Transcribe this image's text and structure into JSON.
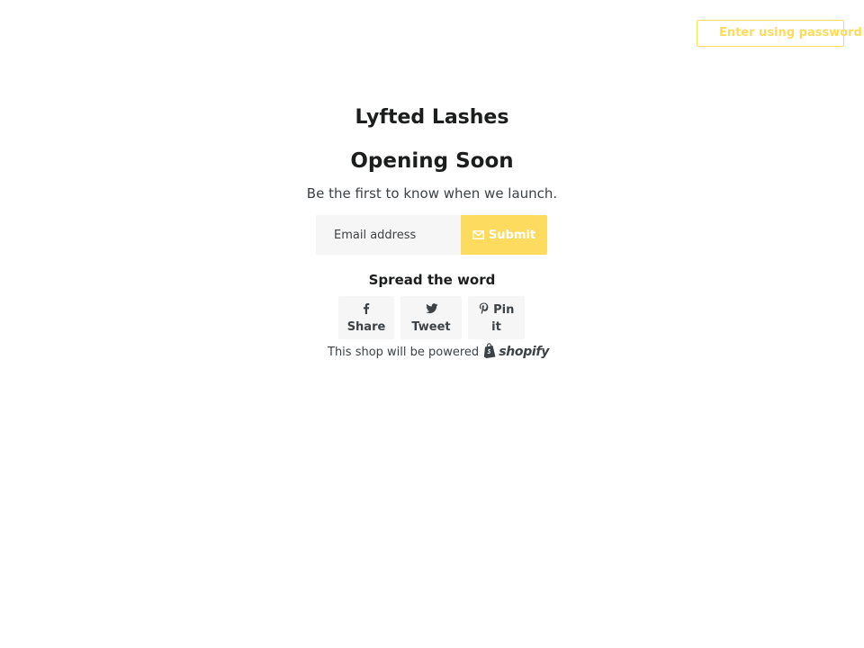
{
  "header": {
    "password_button_label": "Enter using password"
  },
  "main": {
    "shop_name": "Lyfted Lashes",
    "headline": "Opening Soon",
    "subtext": "Be the first to know when we launch.",
    "signup": {
      "email_placeholder": "Email address",
      "email_value": "",
      "submit_label": "Submit",
      "submit_icon": "envelope-icon"
    },
    "social": {
      "title": "Spread the word",
      "buttons": [
        {
          "icon": "facebook-icon",
          "label": "Share"
        },
        {
          "icon": "twitter-icon",
          "label": "Tweet"
        },
        {
          "icon": "pinterest-icon",
          "label_line1": "Pin",
          "label_line2": "it"
        }
      ]
    },
    "footer": {
      "powered_text": "This shop will be powered",
      "logo_text": "shopify",
      "logo_icon": "shopify-bag-icon"
    }
  },
  "colors": {
    "accent": "#fddb5e",
    "text_dark": "#1c1d1d",
    "text_body": "#3d4246",
    "input_bg": "#f6f6f6"
  }
}
